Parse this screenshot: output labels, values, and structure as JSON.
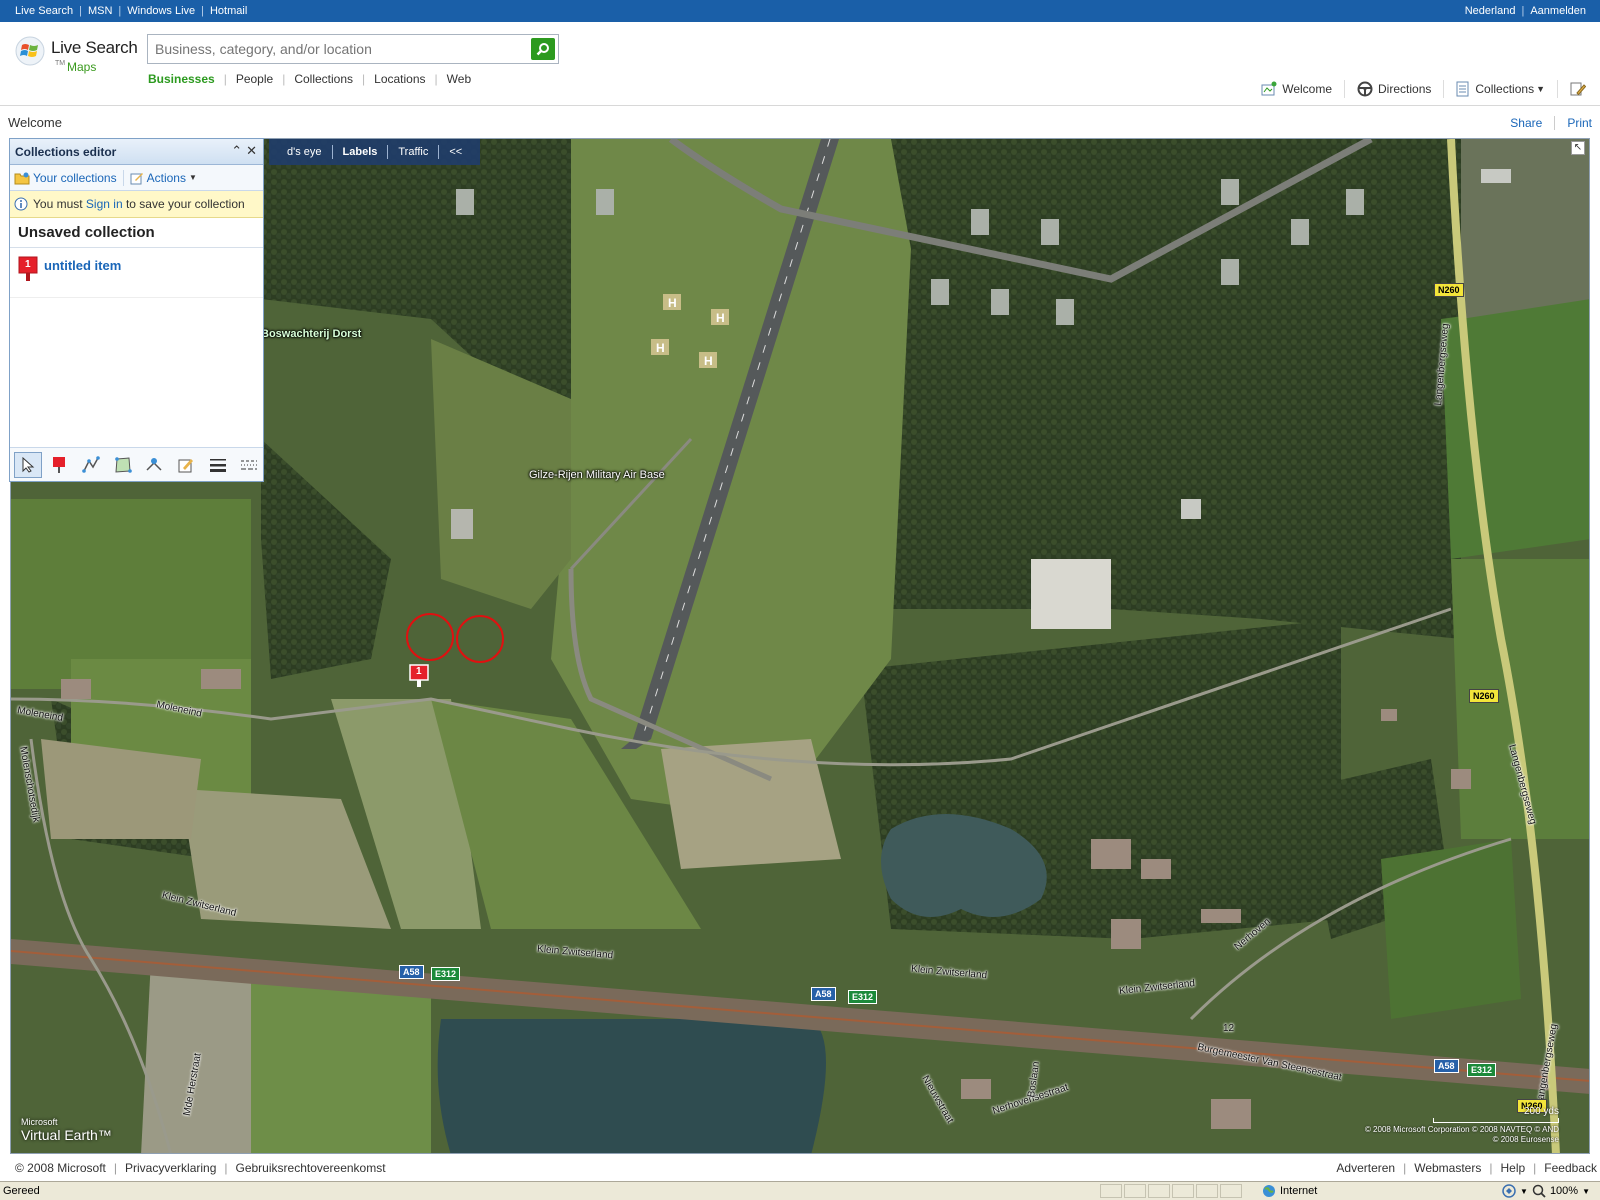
{
  "topbar": {
    "links": [
      "Live Search",
      "MSN",
      "Windows Live",
      "Hotmail"
    ],
    "right": [
      "Nederland",
      "Aanmelden"
    ]
  },
  "logo": {
    "line1": "Live Search",
    "line2": "Maps",
    "tm": "TM"
  },
  "search": {
    "placeholder": "Business, category, and/or location",
    "value": ""
  },
  "tabs": [
    "Businesses",
    "People",
    "Collections",
    "Locations",
    "Web"
  ],
  "rightnav": {
    "welcome": "Welcome",
    "directions": "Directions",
    "collections": "Collections"
  },
  "page": {
    "title": "Welcome",
    "share": "Share",
    "print": "Print"
  },
  "maptoolbar": {
    "birdseye": "d's eye",
    "labels": "Labels",
    "traffic": "Traffic",
    "collapse": "<<"
  },
  "collections_editor": {
    "title": "Collections editor",
    "your_collections": "Your collections",
    "actions": "Actions",
    "notice_pre": "You must ",
    "notice_link": "Sign in",
    "notice_post": " to save your collection",
    "collection_name": "Unsaved collection",
    "items": [
      {
        "number": "1",
        "label": "untitled item"
      }
    ],
    "tools": [
      "select-tool",
      "pushpin-tool",
      "polyline-tool",
      "polygon-tool",
      "import-tool",
      "edit-tool",
      "list-tool",
      "layer-tool"
    ]
  },
  "map": {
    "places": [
      "Boswachterij Dorst",
      "Gilze-Rijen Military Air Base"
    ],
    "roads": [
      "Moleneind",
      "Moleneind",
      "Molenschotsedijk",
      "Klein Zwitserland",
      "Klein Zwitserland",
      "Klein Zwitserland",
      "Klein Zwitserland",
      "Langenbergseweg",
      "Langenbergseweg",
      "Langenbergseweg",
      "Nerhoven",
      "Burgemeester Van Steensestraat",
      "Nerhovensestraat",
      "Nieuwstraat",
      "Boslaan",
      "Mde Herstraat"
    ],
    "shields": {
      "a58": "A58",
      "e312": "E312",
      "n260": "N260",
      "exit": "12"
    },
    "pin_number": "1",
    "scale": "200 yds",
    "copyright": [
      "© 2008 Microsoft Corporation   © 2008 NAVTEQ   © AND",
      "© 2008 Eurosense"
    ],
    "ve_small": "Microsoft",
    "ve_big": "Virtual Earth™"
  },
  "footer": {
    "left": [
      "© 2008 Microsoft",
      "Privacyverklaring",
      "Gebruiksrechtovereenkomst"
    ],
    "right": [
      "Adverteren",
      "Webmasters",
      "Help",
      "Feedback"
    ]
  },
  "status": {
    "text": "Gereed",
    "zone": "Internet",
    "zoom": "100%"
  },
  "colors": {
    "topbar": "#1a5fa8",
    "accent_green": "#2c9a1f",
    "link": "#1a66b8"
  }
}
